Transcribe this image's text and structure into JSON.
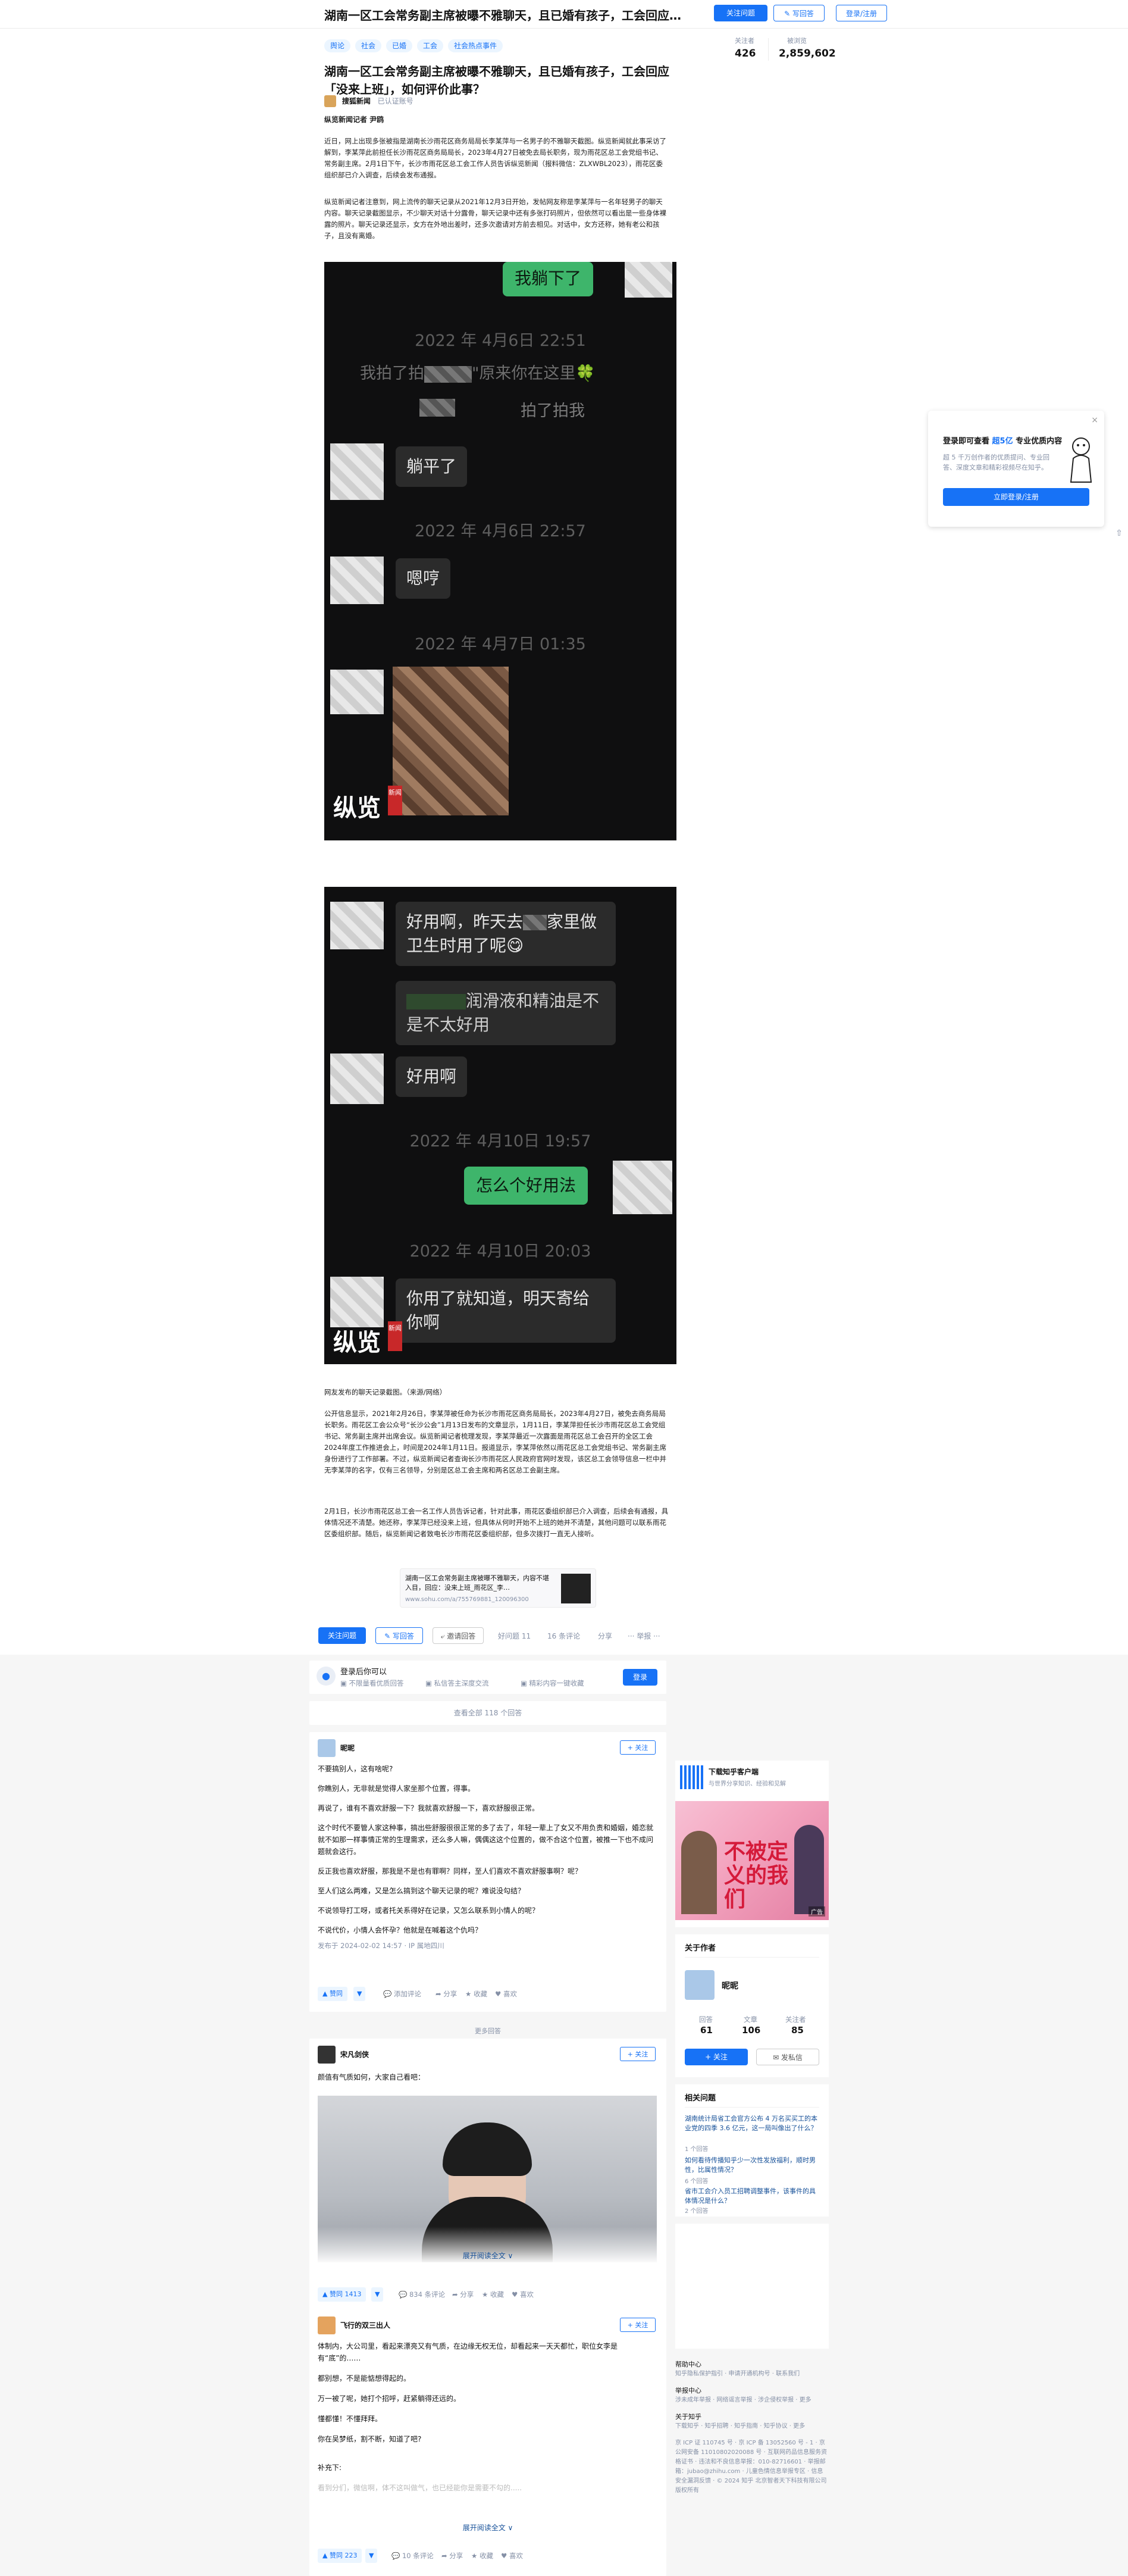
{
  "header": {
    "title": "湖南一区工会常务副主席被曝不雅聊天，且已婚有孩子，工会回应…",
    "follow_q": "关注问题",
    "write": "✎ 写回答",
    "login": "登录/注册"
  },
  "topics": [
    "舆论",
    "社会",
    "已婚",
    "工会",
    "社会热点事件"
  ],
  "stats": {
    "followers_label": "关注者",
    "followers": "426",
    "views_label": "被浏览",
    "views": "2,859,602"
  },
  "question": "湖南一区工会常务副主席被曝不雅聊天，且已婚有孩子，工会回应「没来上班」，如何评价此事？",
  "author": {
    "name": "搜狐新闻",
    "badge": "已认证账号"
  },
  "byline": "纵览新闻记者 尹鸥",
  "paragraphs": [
    "近日，网上出现多张被指是湖南长沙雨花区商务局局长李某萍与一名男子的不雅聊天截图。纵览新闻就此事采访了解到，李某萍此前担任长沙雨花区商务局局长，2023年4月27日被免去局长职务，现为雨花区总工会党组书记、常务副主席。2月1日下午，长沙市雨花区总工会工作人员告诉纵览新闻（报料微信：ZLXWBL2023），雨花区委组织部已介入调查，后续会发布通报。",
    "纵览新闻记者注意到，网上流传的聊天记录从2021年12月3日开始，发帖网友称是李某萍与一名年轻男子的聊天内容。聊天记录截图显示，不少聊天对话十分露骨，聊天记录中还有多张打码照片，但依然可以看出是一些身体裸露的照片。聊天记录还显示，女方在外地出差时，还多次邀请对方前去相见。对话中，女方还称，她有老公和孩子，且没有离婚。"
  ],
  "chat1": {
    "msg_top": "我躺下了",
    "t1": "2022 年 4月6日 22:51",
    "m1": "我拍了拍",
    "m1b": "\"原来你在这里🍀",
    "m1c": "拍了拍我",
    "m2": "躺平了",
    "t2": "2022 年 4月6日 22:57",
    "m3": "嗯哼",
    "t3": "2022 年 4月7日 01:35",
    "wm": "纵览",
    "wm_badge": "新闻"
  },
  "chat2": {
    "m1": "好用啊，昨天去",
    "m1b": "家里做卫生时用了呢😋",
    "m2": "润滑液和精油是不是不太好用",
    "m3": "好用啊",
    "t1": "2022 年 4月10日 19:57",
    "m4": "怎么个好用法",
    "t2": "2022 年 4月10日 20:03",
    "m5": "你用了就知道，明天寄给你啊",
    "wm": "纵览",
    "wm_badge": "新闻"
  },
  "caption": "网友发布的聊天记录截图。（来源/网络）",
  "paragraphs2": [
    "公开信息显示，2021年2月26日，李某萍被任命为长沙市雨花区商务局局长，2023年4月27日，被免去商务局局长职务。雨花区工会公众号“长沙公会”1月13日发布的文章显示，1月11日，李某萍担任长沙市雨花区总工会党组书记、常务副主席并出席会议。纵览新闻记者梳理发现，李某萍最近一次露面是雨花区总工会召开的全区工会2024年度工作推进会上，时间是2024年1月11日。报道显示，李某萍依然以雨花区总工会党组书记、常务副主席身份进行了工作部署。不过，纵览新闻记者查询长沙市雨花区人民政府官网时发现，该区总工会领导信息一栏中并无李某萍的名字，仅有三名领导，分别是区总工会主席和两名区总工会副主席。",
    "2月1日，长沙市雨花区总工会一名工作人员告诉记者，针对此事，雨花区委组织部已介入调查，后续会有通报，具体情况还不清楚。她还称，李某萍已经没来上班，但具体从何时开始不上班的她并不清楚，其他问题可以联系雨花区委组织部。随后，纵览新闻记者致电长沙市雨花区委组织部，但多次拨打一直无人接听。"
  ],
  "source_card": {
    "title": "湖南一区工会常务副主席被曝不雅聊天，内容不堪入目，回应：没来上班_雨花区_李…",
    "url": "www.sohu.com/a/755769881_120096300"
  },
  "actions": {
    "follow": "关注问题",
    "write": "✎ 写回答",
    "invite": "⤶ 邀请回答",
    "good": "好问题 11",
    "comments": "16 条评论",
    "share": "分享",
    "more": "··· 举报 ···"
  },
  "loginbar": {
    "title": "登录后你可以",
    "i1": "不限量看优质回答",
    "i2": "私信答主深度交流",
    "i3": "精彩内容一键收藏",
    "btn": "登录"
  },
  "view_all": "查看全部 118 个回答",
  "answer1": {
    "name": "昵昵",
    "lines": [
      "不要搞别人，这有啥呢?",
      "你瞧别人，无非就是觉得人家坐那个位置，得事。",
      "再说了，谁有不喜欢舒服一下？我就喜欢舒服一下，喜欢舒服很正常。",
      "这个时代不要管人家这种事，搞出些舒服很很正常的多了去了，年轻一辈上了女又不用负责和婚姻，婚恋就就不如那一样事情正常的生理需求，还么多人嘛，偶偶这这个位置的，做不合这个位置，被推一下也不成问题就会这行。",
      "反正我也喜欢舒服，那我是不是也有罪啊？同样，至人们喜欢不喜欢舒服事啊？呢？",
      "至人们这么两难，又是怎么搞到这个聊天记录的呢？难说没勾结？",
      "不说领导打工呀，或者托关系得好在记录，又怎么联系到小情人的呢？",
      "不说代价，小情人会怀孕？他就是在喊着这个仇吗？"
    ],
    "meta": "发布于 2024-02-02 14:57 · IP 属地四川",
    "vote": "▲ 赞同",
    "c": "添加评论",
    "s": "分享",
    "f": "收藏",
    "l": "喜欢"
  },
  "more_answers": "更多回答",
  "answer2": {
    "name": "宋凡剑侠",
    "line": "颜值有气质如何，大家自己看吧：",
    "expand": "展开阅读全文 ∨",
    "vote": "▲ 赞同 1413",
    "c": "834 条评论",
    "s": "分享",
    "f": "收藏",
    "l": "喜欢"
  },
  "answer3": {
    "name": "飞行的双三出人",
    "lines": [
      "体制内，大公司里，看起来漂亮又有气质，在边缘无权无位，却看起来一天天都忙，职位女李是有“底”的……",
      "都别想，不是能惦想得起的。",
      "万一被了呢，她打个招呼，赶紧躺得还远的。",
      "懂都懂！不懂拜拜。",
      "你在吴梦纸，割不断，知道了吧?"
    ],
    "add": "补充下:",
    "faded": "看到分们，微信啊，体不这叫做气，也已经能你是需要不勾的.....",
    "expand": "展开阅读全文 ∨",
    "vote": "▲ 赞同 223",
    "c": "10 条评论",
    "s": "分享",
    "f": "收藏",
    "l": "喜欢"
  },
  "follow": "+ 关注",
  "sidebar": {
    "app_title": "下载知乎客户端",
    "app_sub": "与世界分享知识、经验和见解",
    "ad_text": "不被定义的我们",
    "ad_label": "广告",
    "about": "关于作者",
    "author": "昵昵",
    "answers_l": "回答",
    "answers": "61",
    "articles_l": "文章",
    "articles": "106",
    "followers_l": "关注者",
    "followers": "85",
    "follow": "+ 关注",
    "msg": "✉ 发私信",
    "related": "相关问题",
    "rq": [
      "湖南统计局省工会官方公布 4 万名买买工的本业党的四季 3.6 亿元，这一局叫像出了什么？",
      "如何看待传播知乎少一次性发放福利，顺时男性，比属性情况？",
      "省市工会介入员工招聘调整事件，该事件的具体情况是什么？"
    ],
    "rq_meta": [
      "1 个回答",
      "6 个回答",
      "2 个回答"
    ],
    "help": "帮助中心",
    "help_links": "知乎隐私保护指引 · 申请开通机构号 · 联系我们",
    "report": "举报中心",
    "report_links": "涉未成年举报 · 网络谣言举报 · 涉企侵权举报 · 更多",
    "about_zhihu": "关于知乎",
    "about_links": "下载知乎 · 知乎招聘 · 知乎指南 · 知乎协议 · 更多",
    "legal": "京 ICP 证 110745 号 · 京 ICP 备 13052560 号 - 1 · 京公网安备 11010802020088 号 · 互联网药品信息服务资格证书 · 违法和不良信息举报：010-82716601 · 举报邮箱：jubao@zhihu.com · 儿童色情信息举报专区 · 信息安全漏洞反馈 · © 2024 知乎 北京智者天下科技有限公司版权所有"
  },
  "popup": {
    "title_a": "登录即可查看",
    "title_b": "超5亿",
    "title_c": "专业优质内容",
    "desc": "超 5 千万创作者的优质提问、专业回答、深度文章和精彩视频尽在知乎。",
    "btn": "立即登录/注册"
  }
}
